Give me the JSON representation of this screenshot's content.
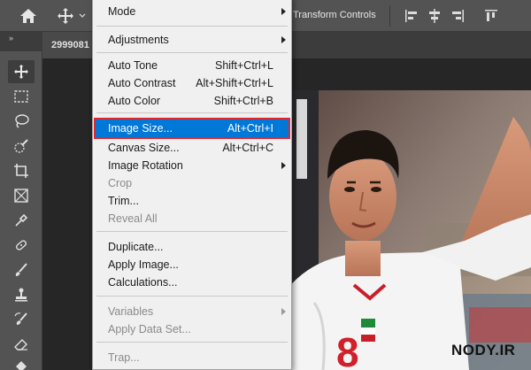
{
  "options_bar": {
    "transform_controls_label": "Transform Controls",
    "icons": [
      "home-icon",
      "move-icon",
      "chevron-down-icon",
      "align-left-icon",
      "align-center-icon",
      "align-right-icon",
      "align-top-icon"
    ]
  },
  "document": {
    "tab_label": "2999081",
    "panel_toggle": "»"
  },
  "toolbar": {
    "tools": [
      "move-tool",
      "marquee-tool",
      "lasso-tool",
      "quick-selection-tool",
      "crop-tool",
      "frame-tool",
      "eyedropper-tool",
      "healing-brush-tool",
      "brush-tool",
      "clone-stamp-tool",
      "history-brush-tool",
      "eraser-tool",
      "paint-bucket-tool"
    ],
    "active": "move-tool"
  },
  "menu": {
    "items": [
      {
        "label": "Mode",
        "shortcut": "",
        "submenu": true,
        "disabled": false
      },
      {
        "label": "Adjustments",
        "shortcut": "",
        "submenu": true,
        "disabled": false
      },
      {
        "label": "Auto Tone",
        "shortcut": "Shift+Ctrl+L",
        "submenu": false,
        "disabled": false
      },
      {
        "label": "Auto Contrast",
        "shortcut": "Alt+Shift+Ctrl+L",
        "submenu": false,
        "disabled": false
      },
      {
        "label": "Auto Color",
        "shortcut": "Shift+Ctrl+B",
        "submenu": false,
        "disabled": false
      },
      {
        "label": "Image Size...",
        "shortcut": "Alt+Ctrl+I",
        "submenu": false,
        "disabled": false,
        "highlighted": true
      },
      {
        "label": "Canvas Size...",
        "shortcut": "Alt+Ctrl+C",
        "submenu": false,
        "disabled": false
      },
      {
        "label": "Image Rotation",
        "shortcut": "",
        "submenu": true,
        "disabled": false
      },
      {
        "label": "Crop",
        "shortcut": "",
        "submenu": false,
        "disabled": true
      },
      {
        "label": "Trim...",
        "shortcut": "",
        "submenu": false,
        "disabled": false
      },
      {
        "label": "Reveal All",
        "shortcut": "",
        "submenu": false,
        "disabled": true
      },
      {
        "label": "Duplicate...",
        "shortcut": "",
        "submenu": false,
        "disabled": false
      },
      {
        "label": "Apply Image...",
        "shortcut": "",
        "submenu": false,
        "disabled": false
      },
      {
        "label": "Calculations...",
        "shortcut": "",
        "submenu": false,
        "disabled": false
      },
      {
        "label": "Variables",
        "shortcut": "",
        "submenu": true,
        "disabled": true
      },
      {
        "label": "Apply Data Set...",
        "shortcut": "",
        "submenu": false,
        "disabled": true
      },
      {
        "label": "Trap...",
        "shortcut": "",
        "submenu": false,
        "disabled": true
      }
    ]
  },
  "photo": {
    "jersey_number": "8"
  },
  "watermark": "NODY.IR",
  "colors": {
    "menu_highlight": "#0078d7",
    "highlight_outline": "#e0262f",
    "ui_dark": "#535353"
  }
}
